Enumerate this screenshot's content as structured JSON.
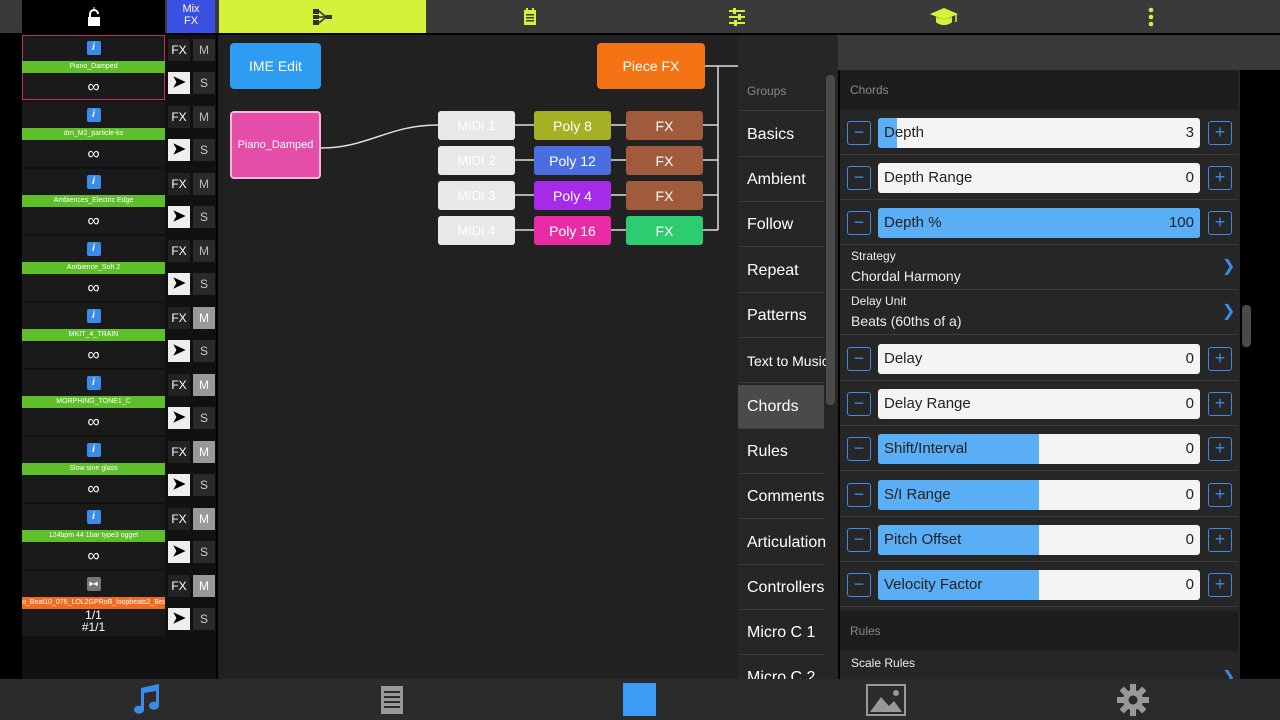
{
  "topbar": {
    "mixfx_label_1": "Mix",
    "mixfx_label_2": "FX",
    "icons": [
      "lock-icon",
      "routing-icon",
      "notepad-icon",
      "sliders-icon",
      "graduation-cap-icon",
      "overflow-menu-icon"
    ],
    "accent": "#d5f23b"
  },
  "tracks": [
    {
      "name": "Piano_Damped",
      "count": "∞",
      "fx": "FX",
      "m": "M",
      "s": "S",
      "m_on": false
    },
    {
      "name": "drn_M2_particle-ks",
      "count": "∞",
      "fx": "FX",
      "m": "M",
      "s": "S",
      "m_on": false
    },
    {
      "name": "Ambiences_Electric Edge",
      "count": "∞",
      "fx": "FX",
      "m": "M",
      "s": "S",
      "m_on": false
    },
    {
      "name": "Ambience_Soft 2",
      "count": "∞",
      "fx": "FX",
      "m": "M",
      "s": "S",
      "m_on": false
    },
    {
      "name": "MKIT_4_TRAIN",
      "count": "∞",
      "fx": "FX",
      "m": "M",
      "s": "S",
      "m_on": true
    },
    {
      "name": "MORPHING_TONE1_C",
      "count": "∞",
      "fx": "FX",
      "m": "M",
      "s": "S",
      "m_on": true
    },
    {
      "name": "Slow sine glass",
      "count": "∞",
      "fx": "FX",
      "m": "M",
      "s": "S",
      "m_on": true
    },
    {
      "name": "124bpm 44 1bar type3 ogget",
      "count": "∞",
      "fx": "FX",
      "m": "M",
      "s": "S",
      "m_on": true
    },
    {
      "name": "o_Beat10_076_LOL2GPRoB_loopbeats2_Beat",
      "count_1": "1/1",
      "count_2": "#1/1",
      "fx": "FX",
      "m": "M",
      "s": "S",
      "m_on": true
    }
  ],
  "canvas": {
    "ime_edit": "IME Edit",
    "piece_fx": "Piece FX",
    "instrument": "Piano_Damped",
    "chains": [
      {
        "midi": "MIDI 1",
        "poly": "Poly 8",
        "poly_color": "#a6b024",
        "fx": "FX",
        "fx_color": "#a05a3c"
      },
      {
        "midi": "MIDI 2",
        "poly": "Poly 12",
        "poly_color": "#4a6ee0",
        "fx": "FX",
        "fx_color": "#a05a3c"
      },
      {
        "midi": "MIDI 3",
        "poly": "Poly 4",
        "poly_color": "#a62be8",
        "fx": "FX",
        "fx_color": "#a05a3c"
      },
      {
        "midi": "MIDI 4",
        "poly": "Poly 16",
        "poly_color": "#e92ca5",
        "fx": "FX",
        "fx_color": "#2ecc71"
      }
    ]
  },
  "groups": {
    "header": "Groups",
    "items": [
      "Basics",
      "Ambient",
      "Follow",
      "Repeat",
      "Patterns",
      "Text to Music",
      "Chords",
      "Rules",
      "Comments",
      "Articulation",
      "Controllers",
      "Micro C 1",
      "Micro C 2"
    ],
    "active": "Chords"
  },
  "chords": {
    "header": "Chords",
    "rows": [
      {
        "type": "slider",
        "label": "Depth",
        "value": "3",
        "fill": 0.06
      },
      {
        "type": "slider",
        "label": "Depth Range",
        "value": "0",
        "fill": 0
      },
      {
        "type": "slider",
        "label": "Depth %",
        "value": "100",
        "fill": 1
      },
      {
        "type": "select",
        "label": "Strategy",
        "value": "Chordal Harmony"
      },
      {
        "type": "select",
        "label": "Delay Unit",
        "value": "Beats (60ths of a)"
      },
      {
        "type": "slider",
        "label": "Delay",
        "value": "0",
        "fill": 0
      },
      {
        "type": "slider",
        "label": "Delay Range",
        "value": "0",
        "fill": 0
      },
      {
        "type": "slider",
        "label": "Shift/Interval",
        "value": "0",
        "fill": 0.5
      },
      {
        "type": "slider",
        "label": "S/I Range",
        "value": "0",
        "fill": 0.5
      },
      {
        "type": "slider",
        "label": "Pitch Offset",
        "value": "0",
        "fill": 0.5
      },
      {
        "type": "slider",
        "label": "Velocity Factor",
        "value": "0",
        "fill": 0.5
      }
    ],
    "rules_header": "Rules",
    "scale_rules": "Scale Rules"
  },
  "bottombar": {
    "icons": [
      "music-note-icon",
      "document-icon",
      "square-icon",
      "image-icon",
      "gear-icon"
    ]
  }
}
